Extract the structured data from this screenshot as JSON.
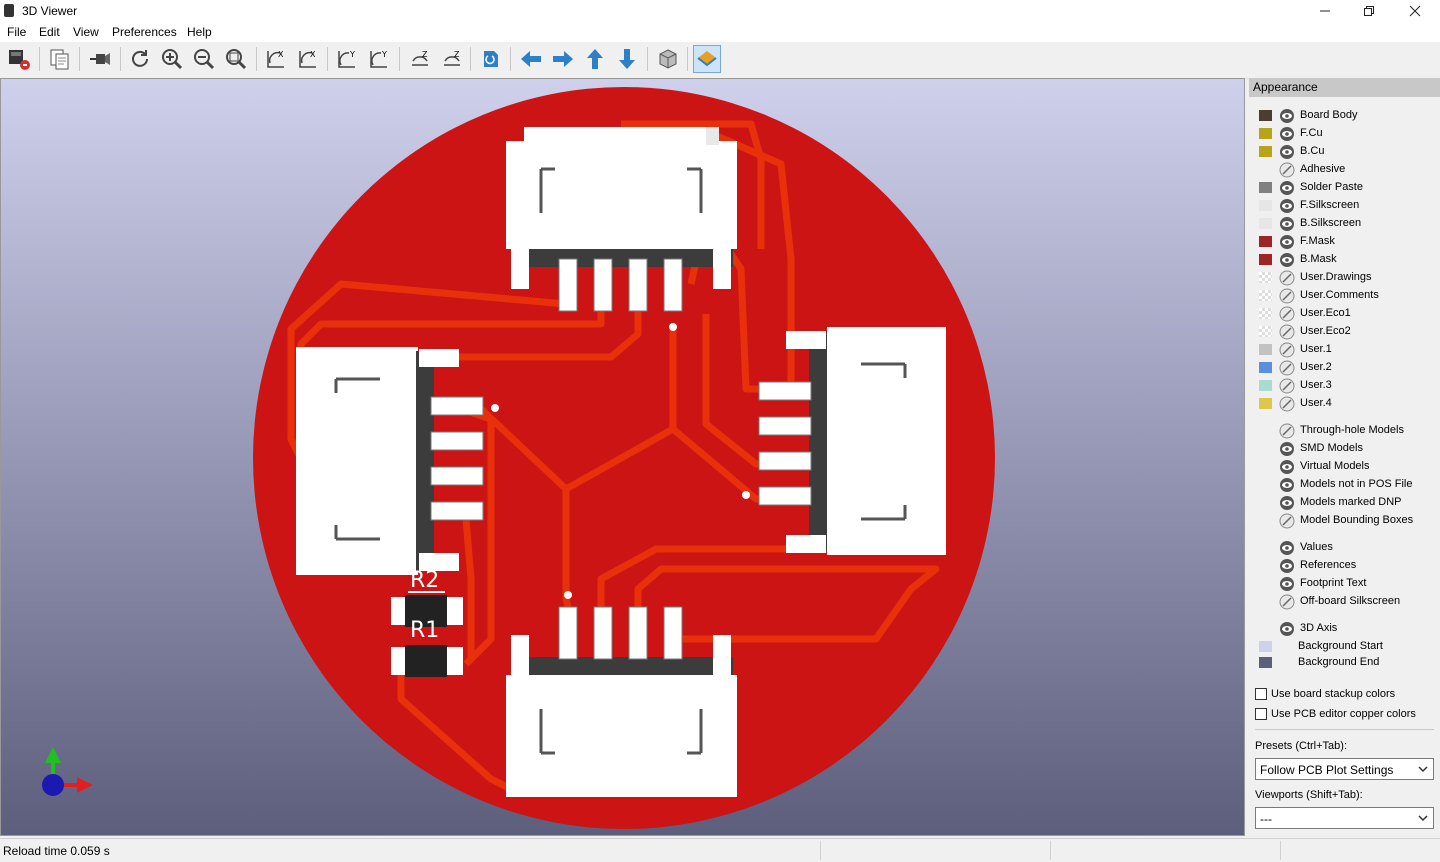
{
  "window": {
    "title": "3D Viewer"
  },
  "menu": [
    "File",
    "Edit",
    "View",
    "Preferences",
    "Help"
  ],
  "panel": {
    "title": "Appearance",
    "layers": [
      {
        "label": "Board Body",
        "color": "#4a3f2e",
        "visible": true
      },
      {
        "label": "F.Cu",
        "color": "#b8a418",
        "visible": true
      },
      {
        "label": "B.Cu",
        "color": "#b8a418",
        "visible": true
      },
      {
        "label": "Adhesive",
        "color": "",
        "visible": false
      },
      {
        "label": "Solder Paste",
        "color": "#808080",
        "visible": true
      },
      {
        "label": "F.Silkscreen",
        "color": "#e6e6e6",
        "visible": true
      },
      {
        "label": "B.Silkscreen",
        "color": "#e6e6e6",
        "visible": true
      },
      {
        "label": "F.Mask",
        "color": "#9c2626",
        "visible": true
      },
      {
        "label": "B.Mask",
        "color": "#9c2626",
        "visible": true
      },
      {
        "label": "User.Drawings",
        "color": "checker",
        "visible": false
      },
      {
        "label": "User.Comments",
        "color": "checker",
        "visible": false
      },
      {
        "label": "User.Eco1",
        "color": "checker",
        "visible": false
      },
      {
        "label": "User.Eco2",
        "color": "checker",
        "visible": false
      },
      {
        "label": "User.1",
        "color": "#c2c2c2",
        "visible": false
      },
      {
        "label": "User.2",
        "color": "#5a8fe0",
        "visible": false
      },
      {
        "label": "User.3",
        "color": "#a9dcd0",
        "visible": false
      },
      {
        "label": "User.4",
        "color": "#dcc84a",
        "visible": false
      }
    ],
    "models": [
      {
        "label": "Through-hole Models",
        "visible": false
      },
      {
        "label": "SMD Models",
        "visible": true
      },
      {
        "label": "Virtual Models",
        "visible": true
      },
      {
        "label": "Models not in POS File",
        "visible": true
      },
      {
        "label": "Models marked DNP",
        "visible": true
      },
      {
        "label": "Model Bounding Boxes",
        "visible": false
      }
    ],
    "annotations": [
      {
        "label": "Values",
        "visible": true
      },
      {
        "label": "References",
        "visible": true
      },
      {
        "label": "Footprint Text",
        "visible": true
      },
      {
        "label": "Off-board Silkscreen",
        "visible": false
      }
    ],
    "axis": {
      "label": "3D Axis",
      "visible": true
    },
    "backgrounds": [
      {
        "label": "Background Start",
        "color": "#cfd0ec"
      },
      {
        "label": "Background End",
        "color": "#5c5e7c"
      }
    ],
    "checkboxes": [
      {
        "label": "Use board stackup colors",
        "checked": false
      },
      {
        "label": "Use PCB editor copper colors",
        "checked": false
      }
    ],
    "presets": {
      "label": "Presets (Ctrl+Tab):",
      "value": "Follow PCB Plot Settings"
    },
    "viewports": {
      "label": "Viewports (Shift+Tab):",
      "value": "---"
    }
  },
  "board": {
    "refs": [
      "R2",
      "R1"
    ],
    "board_color": "#cc1414",
    "trace_color": "#e8300a",
    "connector_color": "#ffffff"
  },
  "status": {
    "text": "Reload time 0.059 s"
  }
}
